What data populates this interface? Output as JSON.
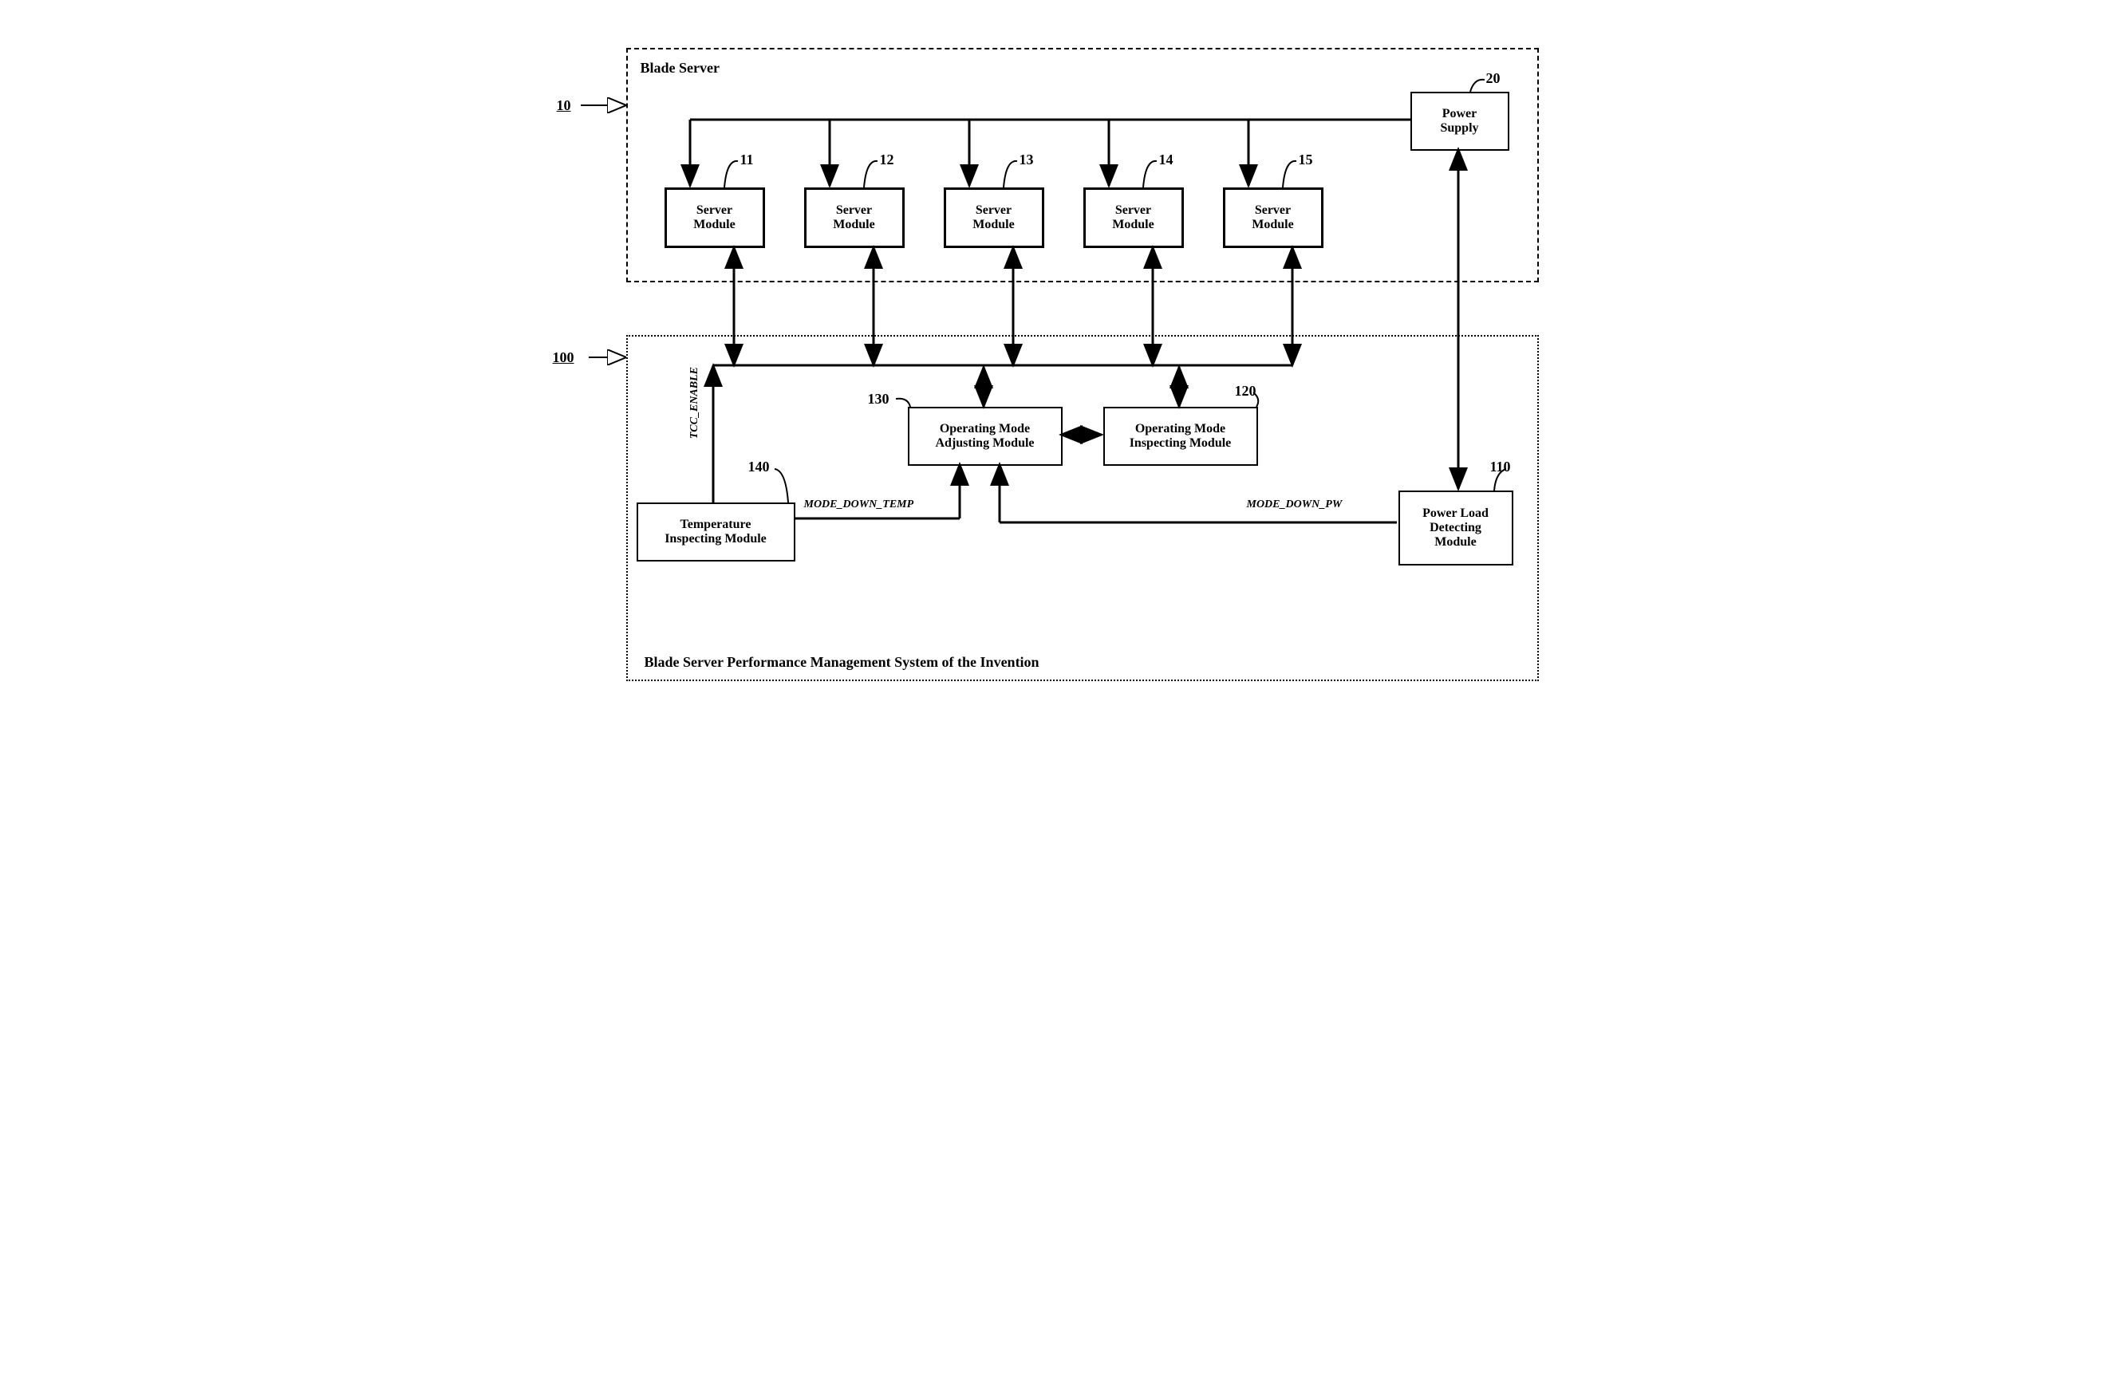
{
  "ref_10": "10",
  "ref_100": "100",
  "blade_server_title": "Blade Server",
  "system_title": "Blade Server Performance Management System of the Invention",
  "power_supply": {
    "label": "Power\nSupply",
    "num": "20"
  },
  "server_modules": [
    {
      "label": "Server\nModule",
      "num": "11"
    },
    {
      "label": "Server\nModule",
      "num": "12"
    },
    {
      "label": "Server\nModule",
      "num": "13"
    },
    {
      "label": "Server\nModule",
      "num": "14"
    },
    {
      "label": "Server\nModule",
      "num": "15"
    }
  ],
  "modules": {
    "adjusting": {
      "label": "Operating Mode\nAdjusting Module",
      "num": "130"
    },
    "inspecting": {
      "label": "Operating Mode\nInspecting Module",
      "num": "120"
    },
    "temperature": {
      "label": "Temperature\nInspecting Module",
      "num": "140"
    },
    "power_load": {
      "label": "Power Load\nDetecting\nModule",
      "num": "110"
    }
  },
  "signals": {
    "tcc_enable": "TCC_ENABLE",
    "mode_down_temp": "MODE_DOWN_TEMP",
    "mode_down_pw": "MODE_DOWN_PW"
  }
}
